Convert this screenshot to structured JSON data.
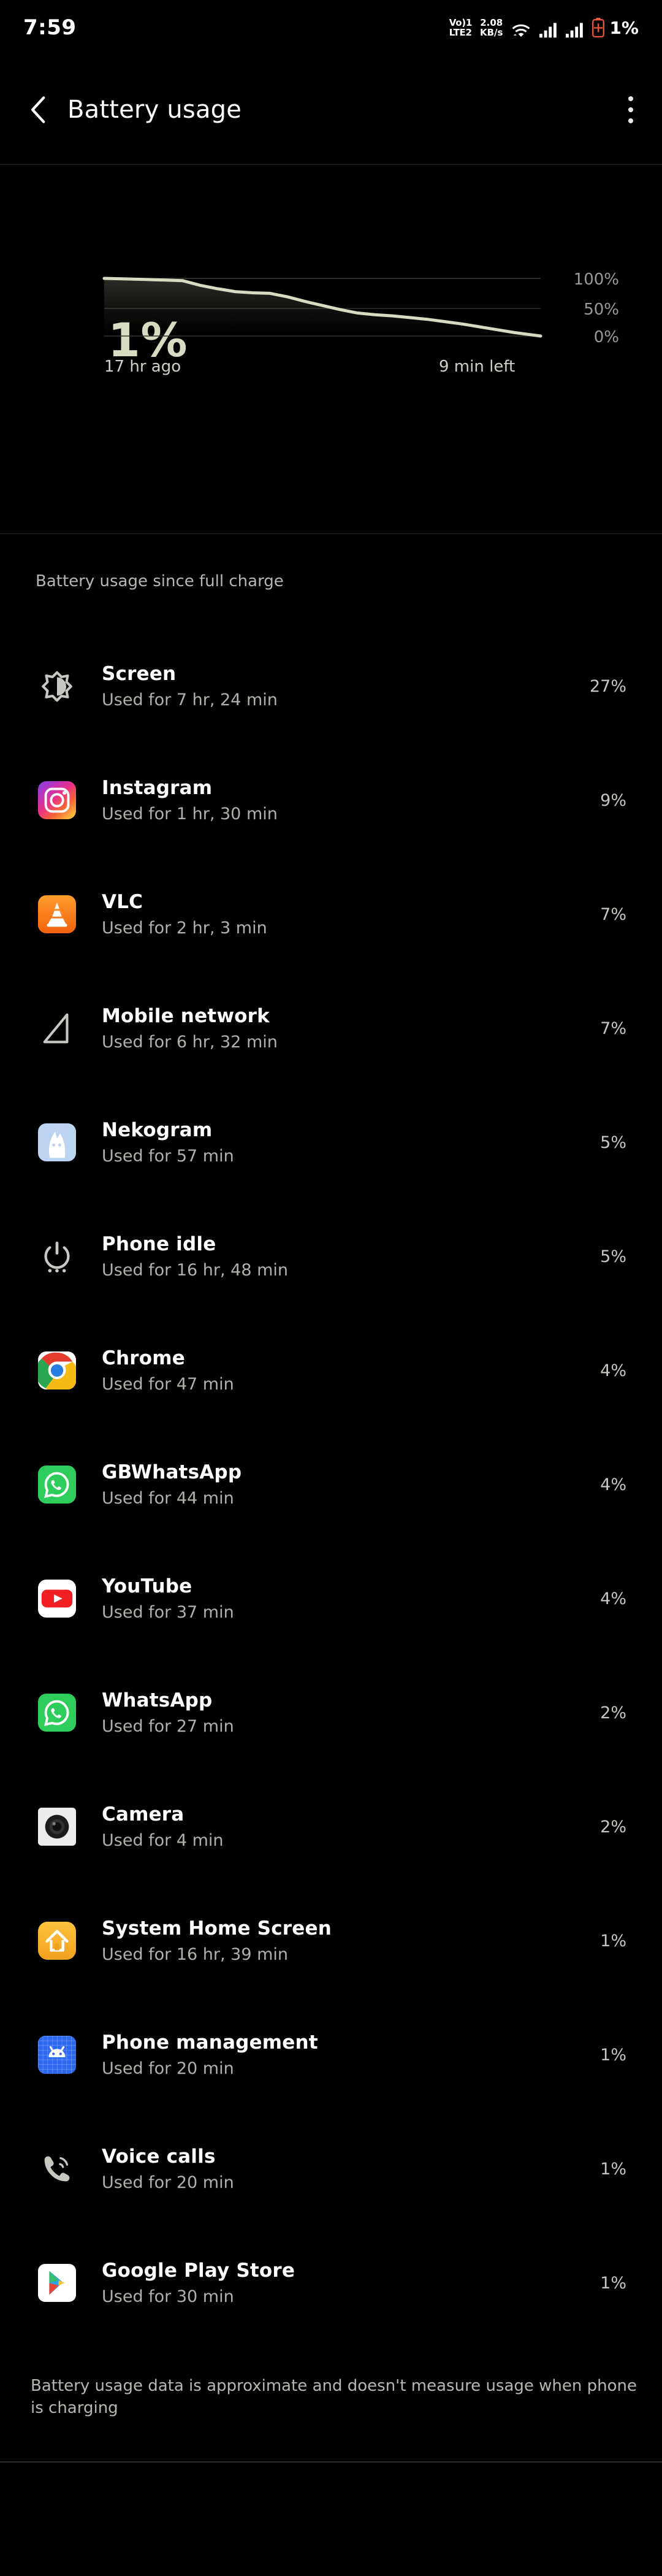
{
  "statusbar": {
    "time": "7:59",
    "volte_line1": "Vo)1",
    "volte_line2": "LTE2",
    "net_speed_value": "2.08",
    "net_speed_unit": "KB/s",
    "wifi_icon": "wifi-icon",
    "signal1_icon": "signal-bars-icon",
    "signal2_icon": "signal-bars-icon",
    "battery_icon": "battery-low-icon",
    "battery_icon_color": "#e8563a",
    "battery_percent": "1%"
  },
  "header": {
    "back_icon": "back-chevron-icon",
    "title": "Battery usage",
    "menu_icon": "overflow-menu-icon"
  },
  "chart_data": {
    "type": "area",
    "title": "1%",
    "xlabel": "",
    "ylabel": "",
    "ylim": [
      0,
      100
    ],
    "ytick_labels": [
      "100%",
      "50%",
      "0%"
    ],
    "ytick_values": [
      100,
      50,
      0
    ],
    "x_start_label": "17 hr ago",
    "x_end_label": "9 min left",
    "grid": true,
    "legend": "none",
    "line_color": "#d9dac2",
    "x": [
      0,
      5,
      10,
      14,
      18,
      22,
      26,
      30,
      34,
      38,
      42,
      46,
      50,
      54,
      58,
      62,
      66,
      70,
      74,
      78,
      82,
      86,
      90,
      94,
      100
    ],
    "values": [
      100,
      99,
      98,
      97,
      96,
      88,
      82,
      77,
      75,
      74,
      68,
      60,
      53,
      46,
      40,
      37,
      35,
      32,
      29,
      25,
      21,
      16,
      11,
      6,
      0
    ]
  },
  "list": {
    "section_title": "Battery usage since full charge",
    "items": [
      {
        "icon": "screen-brightness-icon",
        "name": "Screen",
        "usage": "Used for 7 hr, 24 min",
        "percent": "27%"
      },
      {
        "icon": "instagram-icon",
        "name": "Instagram",
        "usage": "Used for 1 hr, 30 min",
        "percent": "9%"
      },
      {
        "icon": "vlc-icon",
        "name": "VLC",
        "usage": "Used for 2 hr, 3 min",
        "percent": "7%"
      },
      {
        "icon": "mobile-network-icon",
        "name": "Mobile network",
        "usage": "Used for 6 hr, 32 min",
        "percent": "7%"
      },
      {
        "icon": "nekogram-icon",
        "name": "Nekogram",
        "usage": "Used for 57 min",
        "percent": "5%"
      },
      {
        "icon": "power-idle-icon",
        "name": "Phone idle",
        "usage": "Used for 16 hr, 48 min",
        "percent": "5%"
      },
      {
        "icon": "chrome-icon",
        "name": "Chrome",
        "usage": "Used for 47 min",
        "percent": "4%"
      },
      {
        "icon": "gbwhatsapp-icon",
        "name": "GBWhatsApp",
        "usage": "Used for 44 min",
        "percent": "4%"
      },
      {
        "icon": "youtube-icon",
        "name": "YouTube",
        "usage": "Used for 37 min",
        "percent": "4%"
      },
      {
        "icon": "whatsapp-icon",
        "name": "WhatsApp",
        "usage": "Used for 27 min",
        "percent": "2%"
      },
      {
        "icon": "camera-icon",
        "name": "Camera",
        "usage": "Used for 4 min",
        "percent": "2%"
      },
      {
        "icon": "home-screen-icon",
        "name": "System Home Screen",
        "usage": "Used for 16 hr, 39 min",
        "percent": "1%"
      },
      {
        "icon": "phone-management-icon",
        "name": "Phone management",
        "usage": "Used for 20 min",
        "percent": "1%"
      },
      {
        "icon": "voice-calls-icon",
        "name": "Voice calls",
        "usage": "Used for 20 min",
        "percent": "1%"
      },
      {
        "icon": "google-play-icon",
        "name": "Google Play Store",
        "usage": "Used for 30 min",
        "percent": "1%"
      }
    ]
  },
  "footer": {
    "note": "Battery usage data is approximate and doesn't measure usage when phone is charging"
  }
}
